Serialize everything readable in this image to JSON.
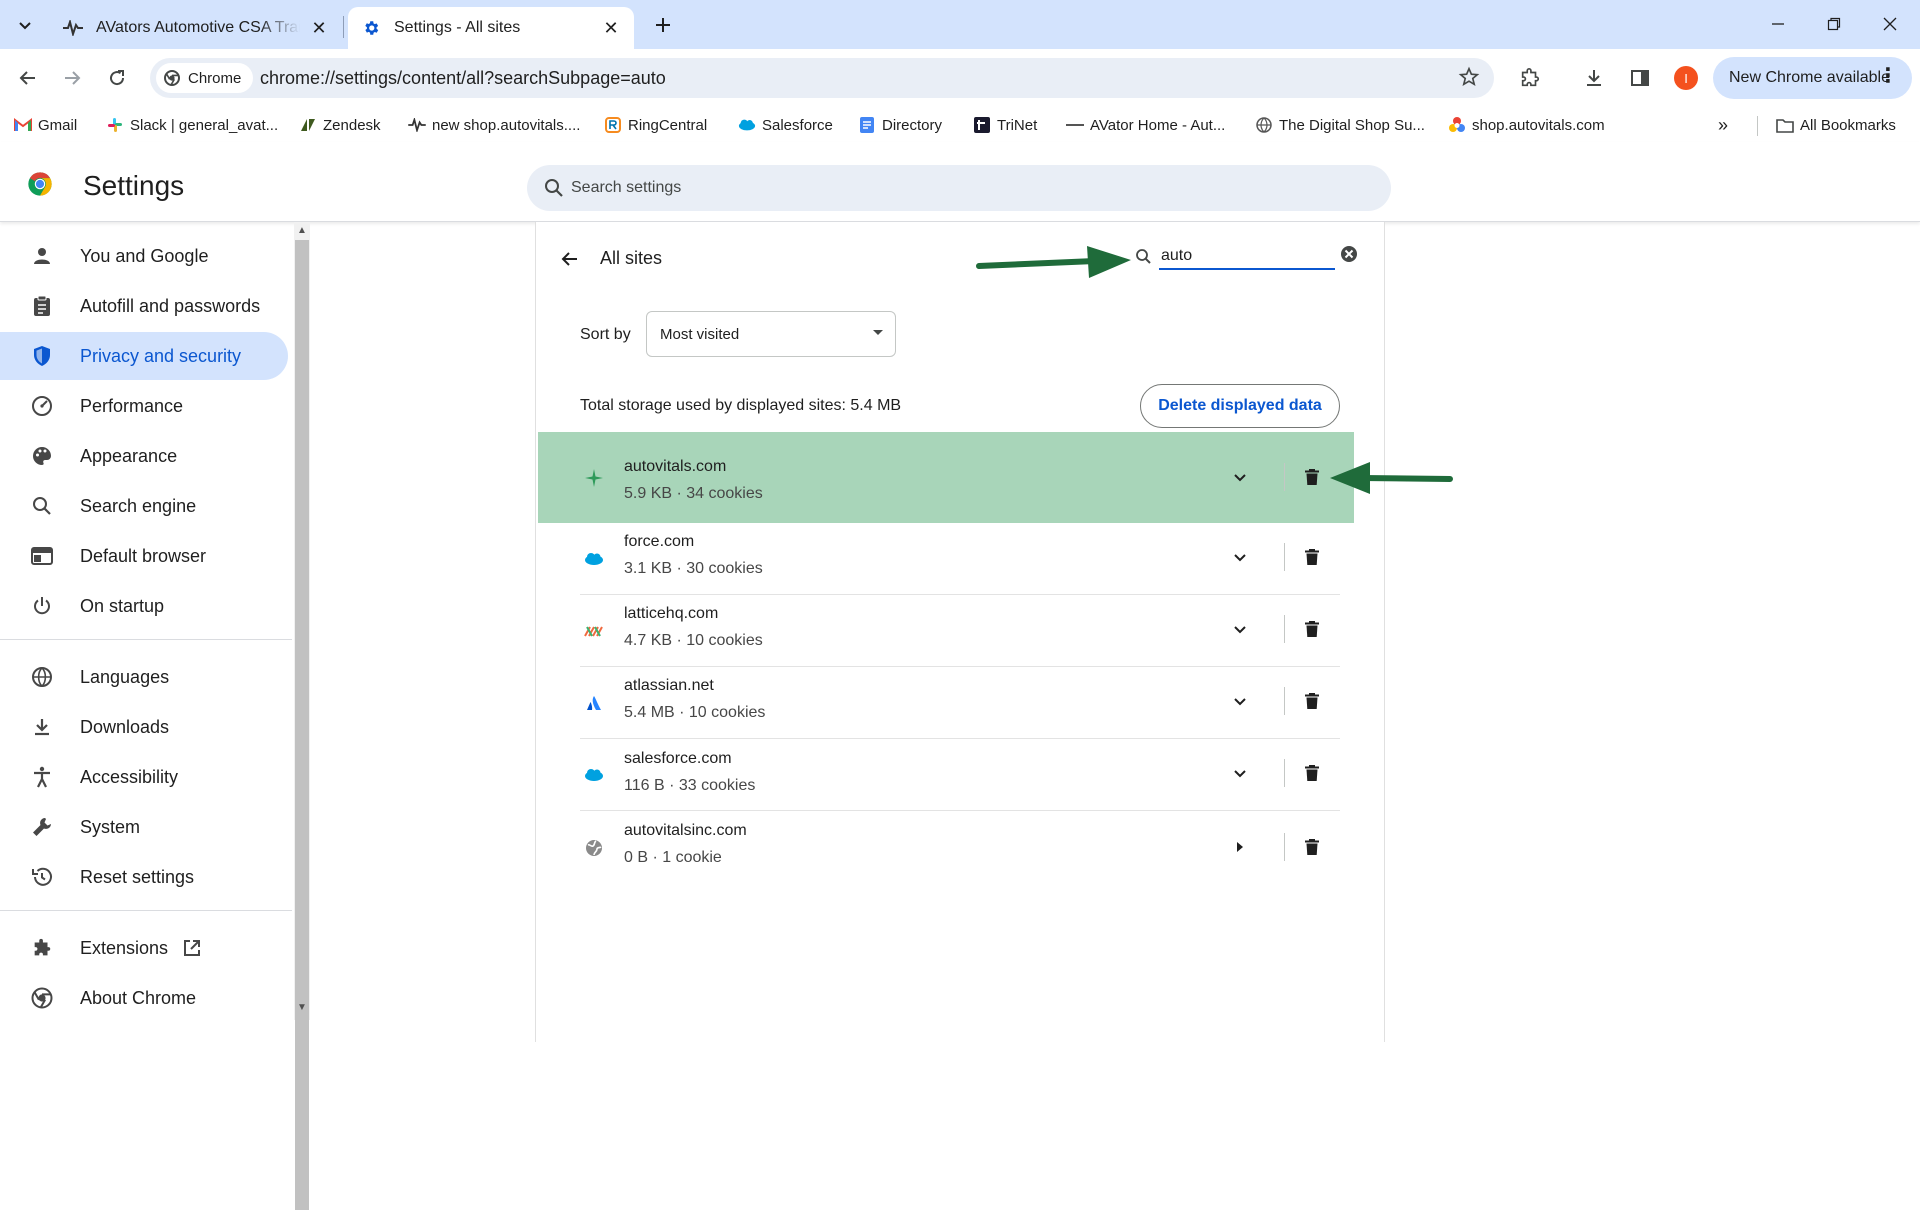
{
  "browser": {
    "tabs": [
      {
        "title": "AVators Automotive CSA Training",
        "icon": "pulse-icon",
        "active": false
      },
      {
        "title": "Settings - All sites",
        "icon": "gear-icon",
        "active": true
      }
    ],
    "url": "chrome://settings/content/all?searchSubpage=auto",
    "chip_label": "Chrome",
    "profile_initial": "I",
    "update_label": "New Chrome available"
  },
  "bookmarks": [
    {
      "label": "Gmail",
      "icon": "gmail-icon"
    },
    {
      "label": "Slack | general_avat...",
      "icon": "slack-icon"
    },
    {
      "label": "Zendesk",
      "icon": "zendesk-icon"
    },
    {
      "label": "new shop.autovitals....",
      "icon": "pulse-icon"
    },
    {
      "label": "RingCentral",
      "icon": "ringcentral-icon"
    },
    {
      "label": "Salesforce",
      "icon": "salesforce-icon"
    },
    {
      "label": "Directory",
      "icon": "directory-icon"
    },
    {
      "label": "TriNet",
      "icon": "trinet-icon"
    },
    {
      "label": "AVator Home - Aut...",
      "icon": "dash-icon"
    },
    {
      "label": "The Digital Shop Su...",
      "icon": "globe-icon"
    },
    {
      "label": "shop.autovitals.com",
      "icon": "autovitals-icon"
    }
  ],
  "all_bookmarks_label": "All Bookmarks",
  "settings": {
    "title": "Settings",
    "search_placeholder": "Search settings"
  },
  "sidebar": {
    "items": [
      {
        "label": "You and Google",
        "icon": "person-icon"
      },
      {
        "label": "Autofill and passwords",
        "icon": "clipboard-icon"
      },
      {
        "label": "Privacy and security",
        "icon": "shield-icon",
        "selected": true
      },
      {
        "label": "Performance",
        "icon": "speedometer-icon"
      },
      {
        "label": "Appearance",
        "icon": "palette-icon"
      },
      {
        "label": "Search engine",
        "icon": "search-icon"
      },
      {
        "label": "Default browser",
        "icon": "browser-icon"
      },
      {
        "label": "On startup",
        "icon": "power-icon"
      },
      {
        "label": "Languages",
        "icon": "globe-icon"
      },
      {
        "label": "Downloads",
        "icon": "download-icon"
      },
      {
        "label": "Accessibility",
        "icon": "accessibility-icon"
      },
      {
        "label": "System",
        "icon": "wrench-icon"
      },
      {
        "label": "Reset settings",
        "icon": "reset-icon"
      },
      {
        "label": "Extensions",
        "icon": "puzzle-icon"
      },
      {
        "label": "About Chrome",
        "icon": "chrome-icon"
      }
    ]
  },
  "main": {
    "title": "All sites",
    "search_value": "auto",
    "sort_label": "Sort by",
    "sort_value": "Most visited",
    "storage_text": "Total storage used by displayed sites: 5.4 MB",
    "delete_label": "Delete displayed data",
    "sites": [
      {
        "name": "autovitals.com",
        "meta": "5.9 KB · 34 cookies",
        "icon": "pulse-icon",
        "highlighted": true
      },
      {
        "name": "force.com",
        "meta": "3.1 KB · 30 cookies",
        "icon": "salesforce-cloud-icon"
      },
      {
        "name": "latticehq.com",
        "meta": "4.7 KB · 10 cookies",
        "icon": "lattice-icon"
      },
      {
        "name": "atlassian.net",
        "meta": "5.4 MB · 10 cookies",
        "icon": "atlassian-icon"
      },
      {
        "name": "salesforce.com",
        "meta": "116 B · 33 cookies",
        "icon": "salesforce-cloud-icon"
      },
      {
        "name": "autovitalsinc.com",
        "meta": "0 B · 1 cookie",
        "icon": "globe-icon"
      }
    ]
  },
  "colors": {
    "accent": "#0b57d0",
    "highlight": "#a8d5b9",
    "annotation_arrow": "#1f6b3a",
    "tabstrip": "#d3e3fd"
  }
}
